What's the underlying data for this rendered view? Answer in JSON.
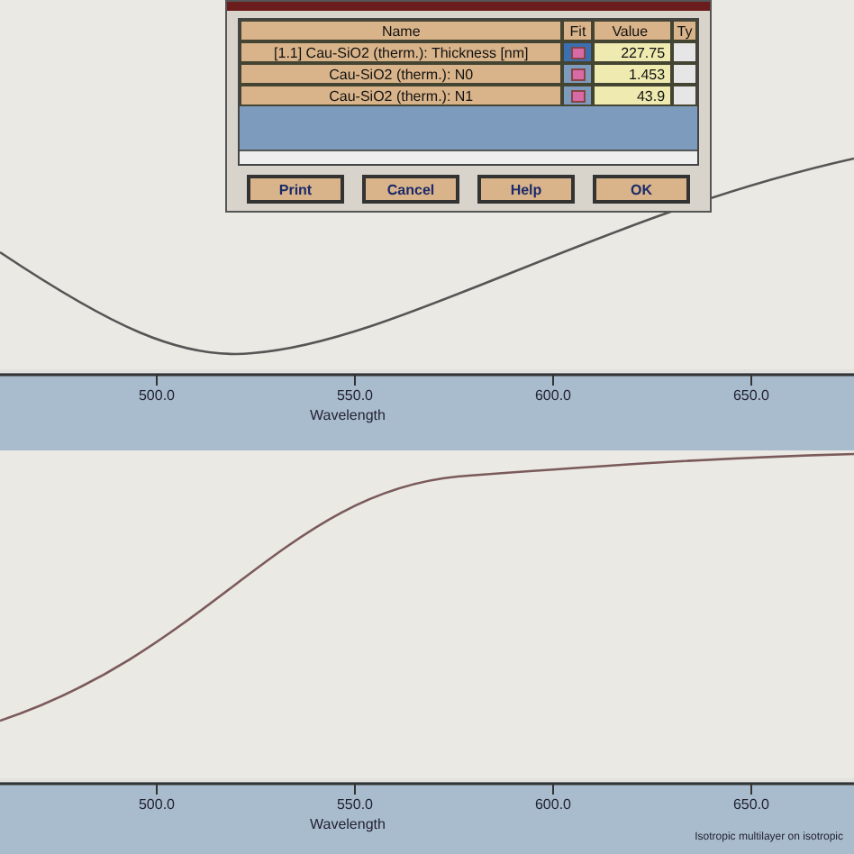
{
  "dialog": {
    "columns": [
      "Name",
      "Fit",
      "Value",
      "Ty"
    ],
    "rows": [
      {
        "name": "[1.1] Cau-SiO2 (therm.): Thickness [nm]",
        "value": "227.75",
        "selected": true
      },
      {
        "name": "Cau-SiO2 (therm.): N0",
        "value": "1.453",
        "selected": false
      },
      {
        "name": "Cau-SiO2 (therm.): N1",
        "value": "43.9",
        "selected": false
      }
    ],
    "buttons": [
      "Print",
      "Cancel",
      "Help",
      "OK"
    ]
  },
  "plots": [
    {
      "ticks": [
        "500.0",
        "550.0",
        "600.0",
        "650.0"
      ],
      "xlabel": "Wavelength"
    },
    {
      "ticks": [
        "500.0",
        "550.0",
        "600.0",
        "650.0"
      ],
      "xlabel": "Wavelength",
      "note": "Isotropic multilayer on isotropic"
    }
  ]
}
